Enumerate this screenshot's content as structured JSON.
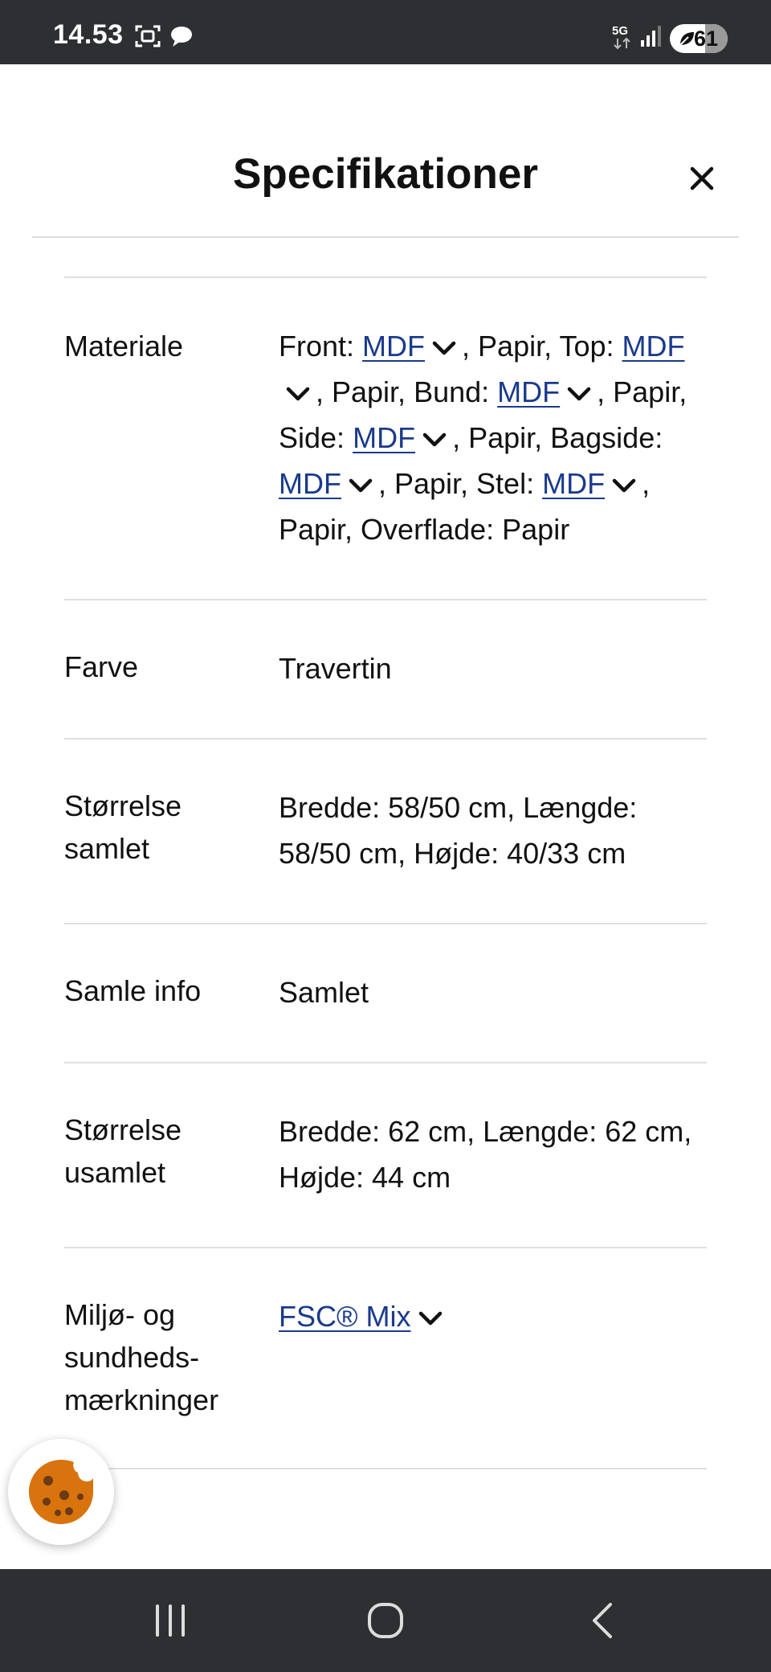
{
  "status_bar": {
    "time": "14.53",
    "network": "5G",
    "battery": "61",
    "battery_level": 0.61,
    "icons": [
      "screenshot-icon",
      "chat-icon",
      "5g-icon",
      "signal-icon",
      "battery-icon"
    ]
  },
  "header": {
    "title": "Specifikationer",
    "close_icon": "close-icon"
  },
  "specs": {
    "materiale": {
      "label": "Materiale",
      "parts": {
        "front": "Front:",
        "top": ", Papir, Top:",
        "bund": ", Papir, Bund:",
        "side": ", Papir, Side:",
        "bagside": ", Papir, Bagside:",
        "stel": ", Papir, Stel:",
        "overflade": ", Papir, Overflade: Papir"
      },
      "link": "MDF"
    },
    "farve": {
      "label": "Farve",
      "value": "Travertin"
    },
    "storrelse_samlet": {
      "label": "Størrelse samlet",
      "value": "Bredde: 58/50 cm, Længde: 58/50 cm, Højde: 40/33 cm"
    },
    "samle_info": {
      "label": "Samle info",
      "value": "Samlet"
    },
    "storrelse_usamlet": {
      "label": "Størrelse usamlet",
      "value": "Bredde: 62 cm, Længde: 62 cm, Højde: 44 cm"
    },
    "miljo": {
      "label": "Miljø- og sundheds- mærkninger",
      "link": "FSC® Mix"
    }
  },
  "floating": {
    "cookie_icon": "cookie-icon"
  },
  "nav_bar": {
    "icons": [
      "recents-icon",
      "home-icon",
      "back-icon"
    ]
  },
  "colors": {
    "status_bar_bg": "#2e2f33",
    "link": "#1a3a8c",
    "divider": "#dfdfdf",
    "cookie": "#d9730d"
  }
}
